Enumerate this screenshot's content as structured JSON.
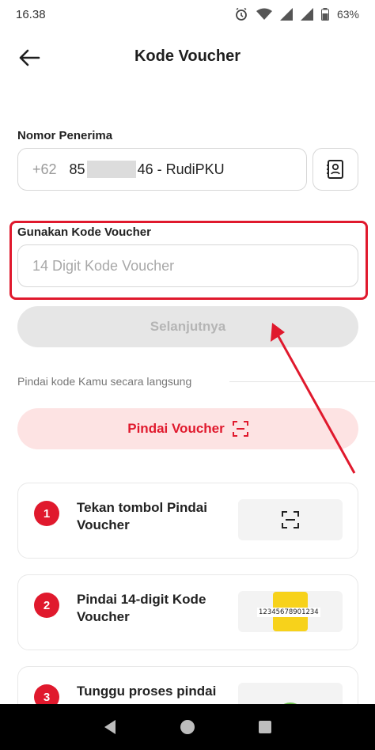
{
  "status_bar": {
    "time": "16.38",
    "battery": "63%"
  },
  "header": {
    "title": "Kode Voucher"
  },
  "recipient": {
    "label": "Nomor Penerima",
    "prefix": "+62",
    "number_start": "85",
    "number_end": "46 - RudiPKU"
  },
  "voucher": {
    "label": "Gunakan Kode Voucher",
    "placeholder": "14 Digit Kode Voucher",
    "value": ""
  },
  "next_button": {
    "label": "Selanjutnya"
  },
  "scan": {
    "hint": "Pindai kode Kamu secara langsung",
    "button_label": "Pindai Voucher"
  },
  "steps": [
    {
      "number": "1",
      "text": "Tekan tombol Pindai Voucher"
    },
    {
      "number": "2",
      "text": "Pindai 14-digit Kode Voucher",
      "sample_code": "12345678901234"
    },
    {
      "number": "3",
      "text": "Tunggu proses pindai"
    }
  ],
  "colors": {
    "brand_red": "#e0192d",
    "scan_button_bg": "#fde3e3",
    "disabled_bg": "#e6e6e6",
    "voucher_yellow": "#f7d21b",
    "check_green": "#6cc04a"
  },
  "icons": {
    "back": "arrow-left-icon",
    "contacts": "contact-book-icon",
    "scan": "scan-frame-icon",
    "check": "check-circle-icon"
  }
}
